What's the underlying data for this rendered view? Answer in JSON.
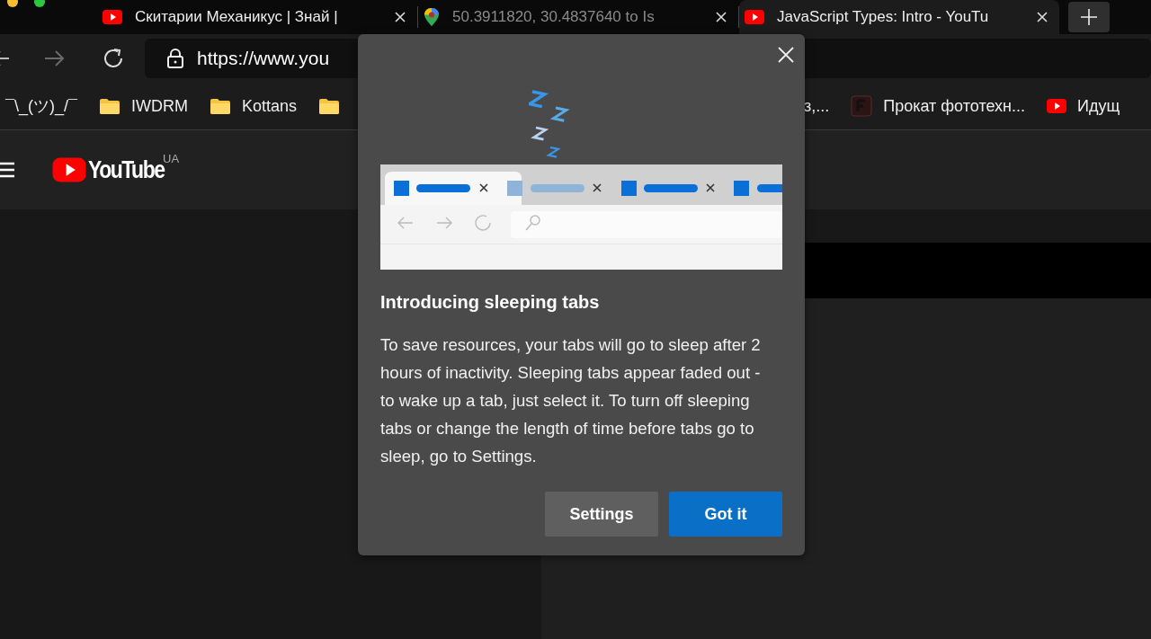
{
  "tabs": [
    {
      "title": "Скитарии Механикус | Знай |",
      "kind": "youtube",
      "selected": false,
      "sleeping": false
    },
    {
      "title": "50.3911820, 30.4837640 to Is",
      "kind": "maps",
      "selected": false,
      "sleeping": true
    },
    {
      "title": "JavaScript Types: Intro - YouTu",
      "kind": "youtube",
      "selected": true,
      "sleeping": false
    }
  ],
  "toolbar": {
    "back_disabled": false,
    "forward_disabled": true,
    "address": "https://www.you"
  },
  "bookmarks": [
    {
      "kind": "text",
      "label": "¯\\_(ツ)_/¯"
    },
    {
      "kind": "folder",
      "label": "IWDRM"
    },
    {
      "kind": "folder",
      "label": "Kottans"
    },
    {
      "kind": "folder"
    },
    {
      "kind": "text",
      "label": "з,..."
    },
    {
      "kind": "f",
      "label": "Прокат фототехн..."
    },
    {
      "kind": "youtube",
      "label": "Идущ"
    }
  ],
  "youtube": {
    "logo": "YouTube",
    "region": "UA"
  },
  "dialog": {
    "title": "Introducing sleeping tabs",
    "body": "To save resources, your tabs will go to sleep after 2 hours of inactivity. Sleeping tabs appear faded out - to wake up a tab, just select it. To turn off sleeping tabs or change the length of time before tabs go to sleep, go to Settings.",
    "buttons": [
      {
        "label": "Settings",
        "kind": "secondary"
      },
      {
        "label": "Got it",
        "kind": "primary"
      }
    ]
  }
}
